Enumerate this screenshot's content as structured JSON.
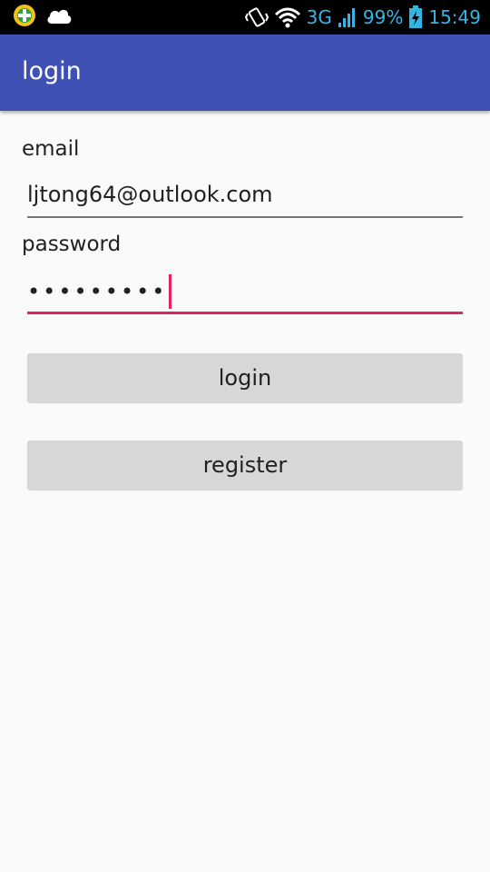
{
  "status_bar": {
    "left_icons": [
      "plus-badge-icon",
      "cloud-icon"
    ],
    "right_icons": [
      "vibrate-icon",
      "wifi-icon",
      "signal-icon",
      "battery-charging-icon"
    ],
    "network": "3G",
    "battery": "99%",
    "time": "15:49",
    "accent_color": "#33b5e5"
  },
  "app_bar": {
    "title": "login",
    "color": "#3f51b5"
  },
  "form": {
    "email_label": "email",
    "email_value": "ljtong64@outlook.com",
    "password_label": "password",
    "password_mask": "•••••••••",
    "focus_color": "#e91e63"
  },
  "buttons": {
    "login_label": "login",
    "register_label": "register"
  }
}
